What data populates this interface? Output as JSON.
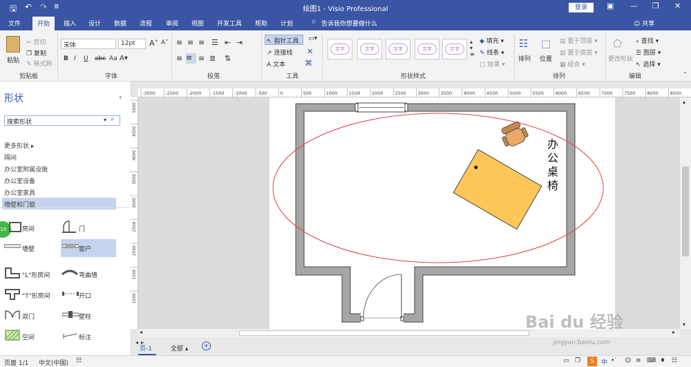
{
  "titlebar": {
    "title": "绘图1  -  Visio Professional",
    "login": "登录",
    "save_icon": "save-icon",
    "undo_icon": "undo-icon",
    "redo_icon": "redo-icon"
  },
  "menu": {
    "items": [
      "文件",
      "开始",
      "插入",
      "设计",
      "数据",
      "流程",
      "审阅",
      "视图",
      "开发工具",
      "帮助",
      "计划"
    ],
    "tell_me": "告诉我你想要做什么",
    "share": "共享"
  },
  "ribbon": {
    "clipboard": {
      "paste": "粘贴",
      "cut": "剪切",
      "copy": "复制",
      "format_painter": "格式刷",
      "label": "剪贴板"
    },
    "font": {
      "name": "宋体",
      "size": "12pt",
      "label": "字体"
    },
    "paragraph": {
      "label": "段落"
    },
    "tools": {
      "pointer": "指针工具",
      "connector": "连接线",
      "text": "文本",
      "label": "工具"
    },
    "shape_styles": {
      "sample": "文字",
      "fill": "填充",
      "line": "线条",
      "effects": "效果",
      "label": "形状样式"
    },
    "arrange": {
      "arrange": "排列",
      "position": "位置",
      "bring_front": "置于顶层",
      "send_back": "置于底层",
      "group": "组合",
      "label": "排列"
    },
    "editing": {
      "change_shape": "更改形状",
      "find": "查找",
      "layers": "图层",
      "select": "选择",
      "label": "编辑"
    }
  },
  "shapes_pane": {
    "title": "形状",
    "search_placeholder": "搜索形状",
    "more_shapes": "更多形状",
    "stencils": [
      "隔间",
      "办公室附属设施",
      "办公室设备",
      "办公室家具",
      "墙壁和门窗"
    ],
    "shapes": [
      {
        "label": "房间",
        "icon": "room-icon"
      },
      {
        "label": "门",
        "icon": "door-icon"
      },
      {
        "label": "墙壁",
        "icon": "wall-icon"
      },
      {
        "label": "窗户",
        "icon": "window-icon"
      },
      {
        "label": "\"L\"形房间",
        "icon": "l-room-icon"
      },
      {
        "label": "弯曲墙",
        "icon": "curved-wall-icon"
      },
      {
        "label": "\"T\"形房间",
        "icon": "t-room-icon"
      },
      {
        "label": "开口",
        "icon": "opening-icon"
      },
      {
        "label": "双门",
        "icon": "double-door-icon"
      },
      {
        "label": "壁柱",
        "icon": "pilaster-icon"
      },
      {
        "label": "空间",
        "icon": "space-icon"
      },
      {
        "label": "标注",
        "icon": "dimension-icon"
      }
    ],
    "badge": "10"
  },
  "ruler": {
    "top": [
      "-3000",
      "-2500",
      "-2000",
      "-1500",
      "-1000",
      "-500",
      "0",
      "500",
      "1000",
      "1500",
      "2000",
      "2500",
      "3000",
      "3500",
      "4000",
      "4500",
      "5000",
      "5500",
      "6000",
      "6500",
      "7000",
      "7500",
      "8000",
      "8500"
    ],
    "left": [
      "5000",
      "4500",
      "4000",
      "3500",
      "3000",
      "2500",
      "2000",
      "1500",
      "1000"
    ]
  },
  "canvas": {
    "annotation": "办公桌椅"
  },
  "tabs": {
    "page": "页-1",
    "all": "全部",
    "add_icon": "add-page-icon"
  },
  "status": {
    "page": "页面 1/1",
    "language": "中文(中国)"
  },
  "watermark": {
    "brand": "Bai du 经验",
    "url": "jingyan.baidu.com"
  }
}
